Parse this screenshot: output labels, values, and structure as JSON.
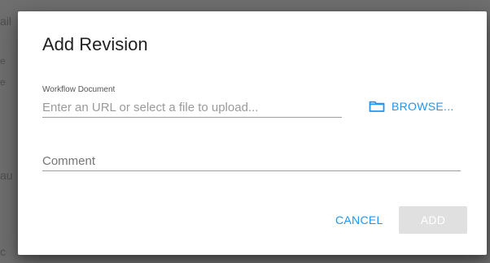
{
  "background": {
    "fragments": {
      "left_1": "ail",
      "left_2": "e",
      "left_3": "e",
      "left_4": "au",
      "left_5": "c",
      "right_1": "r",
      "right_2": "e",
      "bottom_right": ""
    }
  },
  "dialog": {
    "title": "Add Revision",
    "workflow_document": {
      "label": "Workflow Document",
      "placeholder": "Enter an URL or select a file to upload...",
      "value": ""
    },
    "browse": {
      "icon": "folder-icon",
      "label": "BROWSE..."
    },
    "comment": {
      "placeholder": "Comment",
      "value": ""
    },
    "actions": {
      "cancel_label": "CANCEL",
      "add_label": "ADD",
      "add_disabled": true
    },
    "colors": {
      "accent": "#2196f3",
      "disabled_button": "#e0e0e0"
    }
  }
}
